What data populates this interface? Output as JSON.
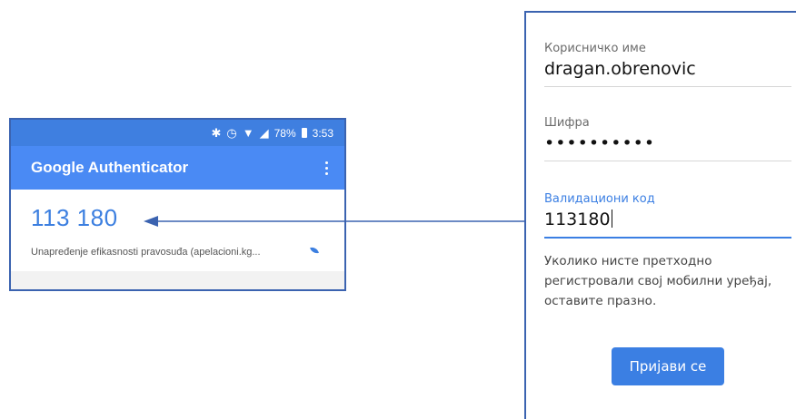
{
  "phone": {
    "status_bar": {
      "icons": [
        "bluetooth-icon",
        "alarm-icon",
        "wifi-icon",
        "signal-icon"
      ],
      "battery": "78%",
      "time": "3:53"
    },
    "app_title": "Google Authenticator",
    "entry": {
      "code": "113 180",
      "account": "Unapređenje efikasnosti pravosuđa (apelacioni.kg..."
    },
    "accent_color": "#4a8af4"
  },
  "login": {
    "username_label": "Корисничко име",
    "username_value": "dragan.obrenovic",
    "password_label": "Шифра",
    "password_value": "••••••••••",
    "code_label": "Валидациони код",
    "code_value": "113180",
    "hint": "Уколико нисте претходно регистровали свој мобилни уређај, оставите празно.",
    "submit_label": "Пријави се",
    "accent_color": "#3b7fe3"
  }
}
